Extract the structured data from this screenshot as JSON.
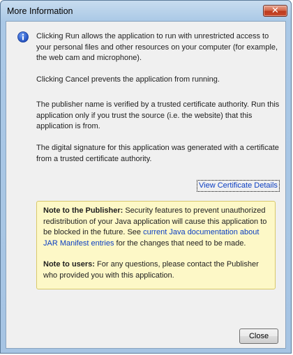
{
  "window": {
    "title": "More Information",
    "close_glyph": "✕"
  },
  "content": {
    "icon": "info-icon",
    "paragraphs": [
      "Clicking Run allows the application to run with unrestricted access to your personal files and other resources on your computer (for example, the web cam and microphone).",
      "Clicking Cancel prevents the application from running.",
      "The publisher name is verified by a trusted certificate authority. Run this application only if you trust the source (i.e. the website) that this application is from.",
      "The digital signature for this application was generated with a certificate from a trusted certificate authority."
    ],
    "view_certificate_link": "View Certificate Details"
  },
  "note": {
    "publisher_heading": "Note to the Publisher:",
    "publisher_text_1": " Security features to prevent unauthorized redistribution of your Java application will cause this application to be blocked in the future. See ",
    "publisher_link": "current Java documentation about JAR Manifest entries",
    "publisher_text_2": " for the changes that need to be made.",
    "users_heading": "Note to users:",
    "users_text": " For any questions, please contact the Publisher who provided you with this application."
  },
  "buttons": {
    "close_label": "Close"
  },
  "colors": {
    "link": "#0b3ec2",
    "note_background": "#fdf8c7",
    "note_border": "#d8c86a"
  }
}
